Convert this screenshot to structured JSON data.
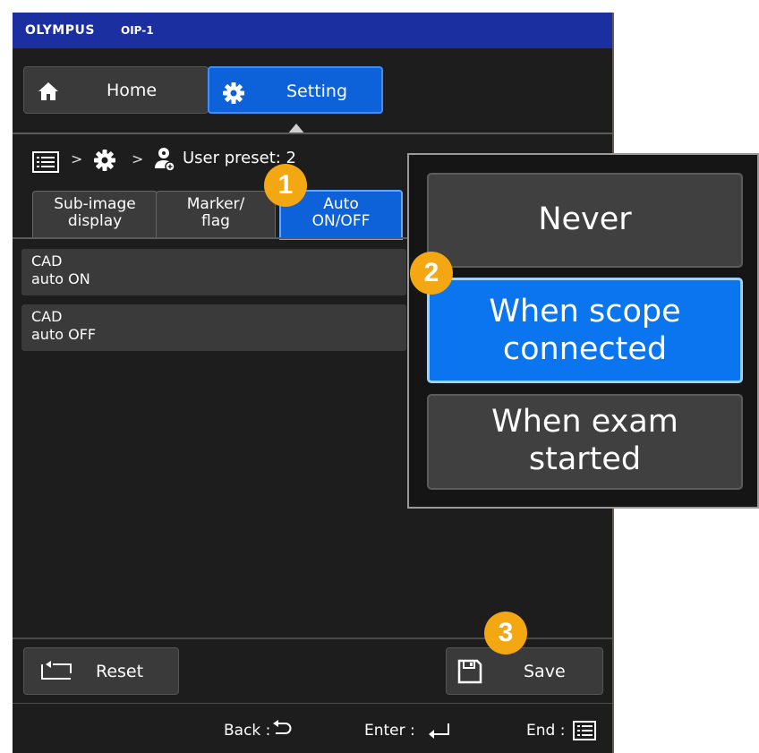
{
  "title_bar": {
    "brand": "OLYMPUS",
    "model": "OIP-1"
  },
  "nav": {
    "home": {
      "label": "Home",
      "icon": "home-icon"
    },
    "setting": {
      "label": "Setting",
      "icon": "gear-icon"
    }
  },
  "breadcrumb": {
    "menu_icon": "menu-list-icon",
    "sep1": ">",
    "gear_icon": "gear-icon",
    "sep2": ">",
    "user_icon": "user-preset-icon",
    "label": "User preset: 2"
  },
  "tabs": [
    {
      "line1": "Sub-image",
      "line2": "display",
      "active": false
    },
    {
      "line1": "Marker/",
      "line2": "flag",
      "active": false
    },
    {
      "line1": "Auto",
      "line2": "ON/OFF",
      "active": true
    }
  ],
  "settings_rows": [
    {
      "line1": "CAD",
      "line2": "auto ON"
    },
    {
      "line1": "CAD",
      "line2": "auto OFF"
    }
  ],
  "actions": {
    "reset": {
      "label": "Reset",
      "icon": "reset-icon"
    },
    "save": {
      "label": "Save",
      "icon": "floppy-disk-icon"
    }
  },
  "status_bar": {
    "back": "Back :",
    "enter": "Enter :",
    "end": "End :"
  },
  "popup": {
    "options": [
      {
        "line1": "Never",
        "line2": "",
        "selected": false
      },
      {
        "line1": "When scope",
        "line2": "connected",
        "selected": true
      },
      {
        "line1": "When exam",
        "line2": "started",
        "selected": false
      }
    ]
  },
  "callouts": [
    "1",
    "2",
    "3"
  ],
  "colors": {
    "accent_blue": "#0d62d9",
    "selected_blue": "#0b74ef",
    "title_bar": "#1b2fa0",
    "callout": "#f3a712"
  }
}
